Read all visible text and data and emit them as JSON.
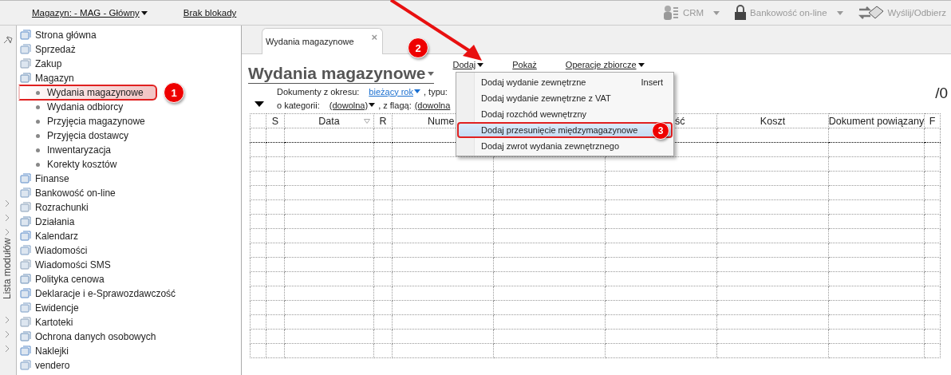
{
  "top_bar": {
    "warehouse": "Magazyn: - MAG - Główny",
    "lock": "Brak blokady",
    "tools": [
      {
        "label": "CRM",
        "kind": "crm",
        "dropdown": true
      },
      {
        "label": "Bankowość on-line",
        "kind": "bank",
        "dropdown": true
      },
      {
        "label": "Wyślij/Odbierz",
        "kind": "send",
        "dropdown": false
      }
    ]
  },
  "sidebar": {
    "title": "Lista modułów",
    "items": [
      {
        "label": "Strona główna"
      },
      {
        "label": "Sprzedaż"
      },
      {
        "label": "Zakup"
      },
      {
        "label": "Magazyn",
        "children": [
          {
            "label": "Wydania magazynowe",
            "selected": true,
            "badge": "1"
          },
          {
            "label": "Wydania odbiorcy",
            "selected": false
          },
          {
            "label": "Przyjęcia magazynowe",
            "selected": false
          },
          {
            "label": "Przyjęcia dostawcy",
            "selected": false
          },
          {
            "label": "Inwentaryzacja",
            "selected": false
          },
          {
            "label": "Korekty kosztów",
            "selected": false
          }
        ]
      },
      {
        "label": "Finanse"
      },
      {
        "label": "Bankowość on-line"
      },
      {
        "label": "Rozrachunki"
      },
      {
        "label": "Działania"
      },
      {
        "label": "Kalendarz"
      },
      {
        "label": "Wiadomości"
      },
      {
        "label": "Wiadomości SMS"
      },
      {
        "label": "Polityka cenowa"
      },
      {
        "label": "Deklaracje i e-Sprawozdawczość"
      },
      {
        "label": "Ewidencje"
      },
      {
        "label": "Kartoteki"
      },
      {
        "label": "Ochrona danych osobowych"
      },
      {
        "label": "Naklejki"
      },
      {
        "label": "vendero"
      }
    ]
  },
  "tab": {
    "label": "Wydania magazynowe",
    "close": "×"
  },
  "title": "Wydania magazynowe",
  "actions": [
    {
      "label": "Dodaj",
      "dropdown": true,
      "badge": "2"
    },
    {
      "label": "Pokaż",
      "dropdown": false
    },
    {
      "label": "Operacje zbiorcze",
      "dropdown": true
    }
  ],
  "filters": {
    "period_label": "Dokumenty z okresu:",
    "period_value": "bieżący rok",
    "type_label": ", typu:",
    "category_label": "o kategorii:",
    "category_value": "(dowolna)",
    "flag_label": ", z flagą:",
    "flag_value": "(dowolna"
  },
  "count": "/0",
  "table": {
    "columns": [
      {
        "kind": "blank"
      },
      {
        "kind": "text",
        "label": "S"
      },
      {
        "kind": "text",
        "label": "Data",
        "sorted": true
      },
      {
        "kind": "text",
        "label": "R"
      },
      {
        "kind": "clip_end",
        "label": "Nume"
      },
      {
        "kind": "blank"
      },
      {
        "kind": "clip_start",
        "label": "ść"
      },
      {
        "kind": "text",
        "label": "Koszt"
      },
      {
        "kind": "text",
        "label": "Dokument powiązany"
      },
      {
        "kind": "text",
        "label": "F"
      }
    ]
  },
  "menu": {
    "items": [
      {
        "label": "Dodaj wydanie zewnętrzne",
        "shortcut": "Insert",
        "selected": false
      },
      {
        "label": "Dodaj wydanie zewnętrzne z VAT",
        "selected": false
      },
      {
        "label": "Dodaj rozchód wewnętrzny",
        "selected": false
      },
      {
        "label": "Dodaj przesunięcie międzymagazynowe",
        "selected": true,
        "badge": "3"
      },
      {
        "label": "Dodaj zwrot wydania zewnętrznego",
        "selected": false
      }
    ]
  }
}
